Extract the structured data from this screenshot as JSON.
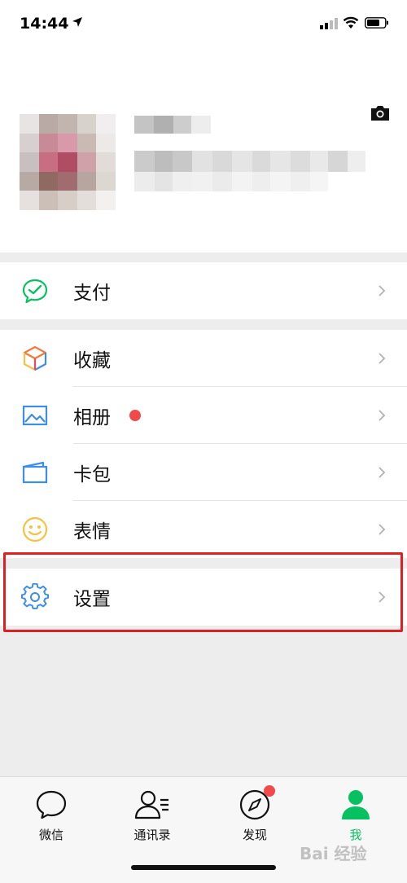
{
  "status": {
    "time": "14:44"
  },
  "menu": {
    "pay": "支付",
    "favorites": "收藏",
    "album": "相册",
    "cards": "卡包",
    "stickers": "表情",
    "settings": "设置"
  },
  "tabs": [
    {
      "label": "微信",
      "icon": "chat-bubble-icon"
    },
    {
      "label": "通讯录",
      "icon": "contacts-icon"
    },
    {
      "label": "发现",
      "icon": "compass-icon"
    },
    {
      "label": "我",
      "icon": "person-icon"
    }
  ],
  "colors": {
    "accent": "#07c160",
    "badge": "#f04a4a",
    "highlight": "#e02020",
    "blue_icon": "#3d8ee8"
  },
  "watermark": "Bai 经验"
}
